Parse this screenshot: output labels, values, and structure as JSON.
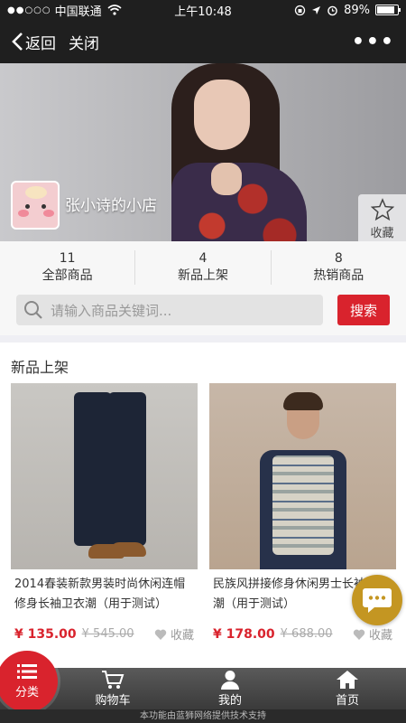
{
  "status_bar": {
    "signal_dots": "●●○○○",
    "carrier": "中国联通",
    "time": "上午10:48",
    "battery": "89%",
    "icons": [
      "wifi-icon",
      "lock-rotation-icon",
      "location-icon",
      "alarm-icon",
      "battery-icon"
    ]
  },
  "nav": {
    "back_label": "返回",
    "close_label": "关闭",
    "more_label": "•••"
  },
  "shop": {
    "name": "张小诗的小店",
    "favorite_label": "收藏"
  },
  "stats": [
    {
      "count": "11",
      "label": "全部商品"
    },
    {
      "count": "4",
      "label": "新品上架"
    },
    {
      "count": "8",
      "label": "热销商品"
    }
  ],
  "search": {
    "placeholder": "请输入商品关键词...",
    "button_label": "搜索"
  },
  "section": {
    "title": "新品上架"
  },
  "products": [
    {
      "title": "2014春装新款男装时尚休闲连帽修身长袖卫衣潮（用于测试）",
      "price": "¥ 135.00",
      "original_price": "¥ 545.00",
      "favorite_label": "收藏"
    },
    {
      "title": "民族风拼接修身休闲男士长袖衬衫潮（用于测试）",
      "price": "¥ 178.00",
      "original_price": "¥ 688.00",
      "favorite_label": "收藏"
    }
  ],
  "tabbar": {
    "category_label": "分类",
    "cart_label": "购物车",
    "mine_label": "我的",
    "home_label": "首页"
  },
  "footer": {
    "note": "本功能由蓝狮网络提供技术支持"
  },
  "colors": {
    "accent": "#d9232d",
    "chat_fab": "#c49622",
    "nav_bg": "#1f1f1f"
  }
}
